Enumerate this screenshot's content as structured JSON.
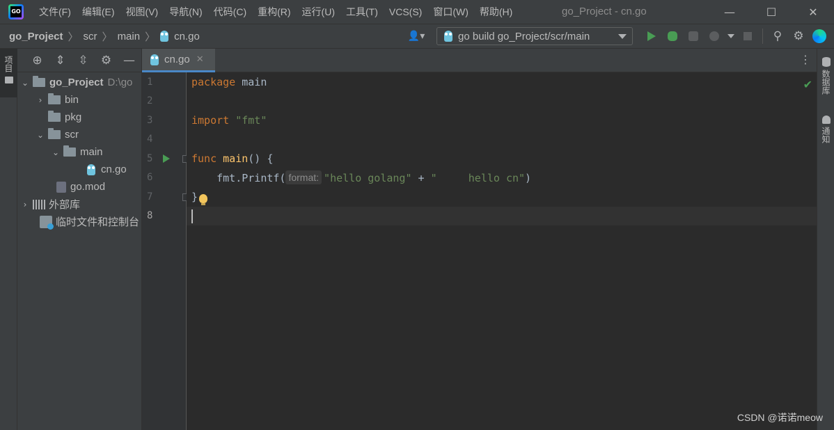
{
  "titlebar": {
    "menu": [
      "文件(F)",
      "编辑(E)",
      "视图(V)",
      "导航(N)",
      "代码(C)",
      "重构(R)",
      "运行(U)",
      "工具(T)",
      "VCS(S)",
      "窗口(W)",
      "帮助(H)"
    ],
    "window_title": "go_Project - cn.go",
    "controls": {
      "minimize": "—",
      "maximize": "☐",
      "close": "✕"
    }
  },
  "breadcrumb": {
    "project": "go_Project",
    "dir1": "scr",
    "dir2": "main",
    "file": "cn.go"
  },
  "toolbar": {
    "run_config": "go build go_Project/scr/main"
  },
  "left_stripe": {
    "project_tab": "项目"
  },
  "project_tree": {
    "root": "go_Project",
    "root_path": "D:\\go",
    "items": [
      "bin",
      "pkg",
      "scr",
      "main",
      "cn.go",
      "go.mod",
      "外部库",
      "临时文件和控制台"
    ]
  },
  "editor": {
    "tab": "cn.go",
    "line_numbers": [
      "1",
      "2",
      "3",
      "4",
      "5",
      "6",
      "7",
      "8"
    ],
    "code": {
      "l1_kw": "package",
      "l1_rest": " main",
      "l3_kw": "import",
      "l3_str": " \"fmt\"",
      "l5_kw": "func",
      "l5_fn": " main",
      "l5_rest": "() {",
      "l6_pre": "    fmt.Printf(",
      "l6_hint": "format:",
      "l6_str1": "\"hello golang\"",
      "l6_op": " + ",
      "l6_str2": "\"     hello cn\"",
      "l6_end": ")",
      "l7": "}"
    }
  },
  "right_stripe": {
    "database": "数据库",
    "notifications": "通知"
  },
  "watermark": "CSDN @诺诺meow"
}
